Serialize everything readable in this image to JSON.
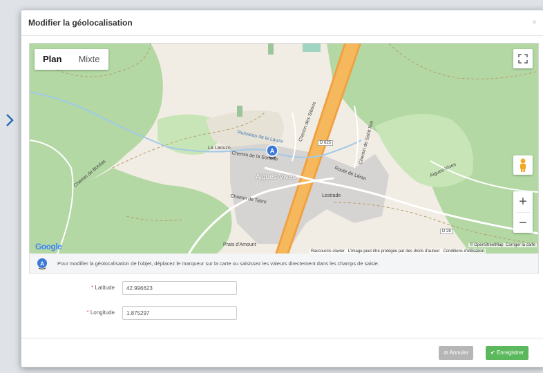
{
  "dialog": {
    "title": "Modifier la géolocalisation",
    "close_label": "×"
  },
  "map": {
    "map_types": [
      "Plan",
      "Mixte"
    ],
    "active_map_type": "Plan",
    "zoom_in_label": "+",
    "zoom_out_label": "−",
    "marker_letter": "A",
    "places": {
      "village": "Aigues-Vives",
      "hamlet_1": "La Laouzo",
      "hamlet_2": "Lestrade",
      "hamlet_3": "Prats d'Amount",
      "stream": "Ruisseau de la Lauze",
      "road_1": "Chemin de la Sonade",
      "road_2": "Chemin des Sibons",
      "road_3": "Route de Léran",
      "road_4": "Chemin de Tabre",
      "road_5": "Aigues-Vives",
      "road_6": "Chemin de Bordas",
      "road_7": "Chemin de Saint Ilon"
    },
    "road_shields": [
      "D 625",
      "D 28"
    ],
    "google_logo": "Google",
    "attribution": {
      "osm": "© OpenStreetMap",
      "fix": "Corriger la carte",
      "keyboard": "Raccourcis clavier",
      "copyright": "L'image peut être protégée par des droits d'auteur",
      "terms": "Conditions d'utilisation"
    }
  },
  "info": {
    "text": "Pour modifier la géolocalisation de l'objet, déplacez le marqueur sur la carte ou saisissez les valeurs directement dans les champs de saisie."
  },
  "form": {
    "latitude": {
      "label": "Latitude",
      "value": "42.996623",
      "required_mark": "*"
    },
    "longitude": {
      "label": "Longitude",
      "value": "1.875297",
      "required_mark": "*"
    }
  },
  "footer": {
    "cancel_label": "Annuler",
    "save_label": "Enregistrer"
  }
}
